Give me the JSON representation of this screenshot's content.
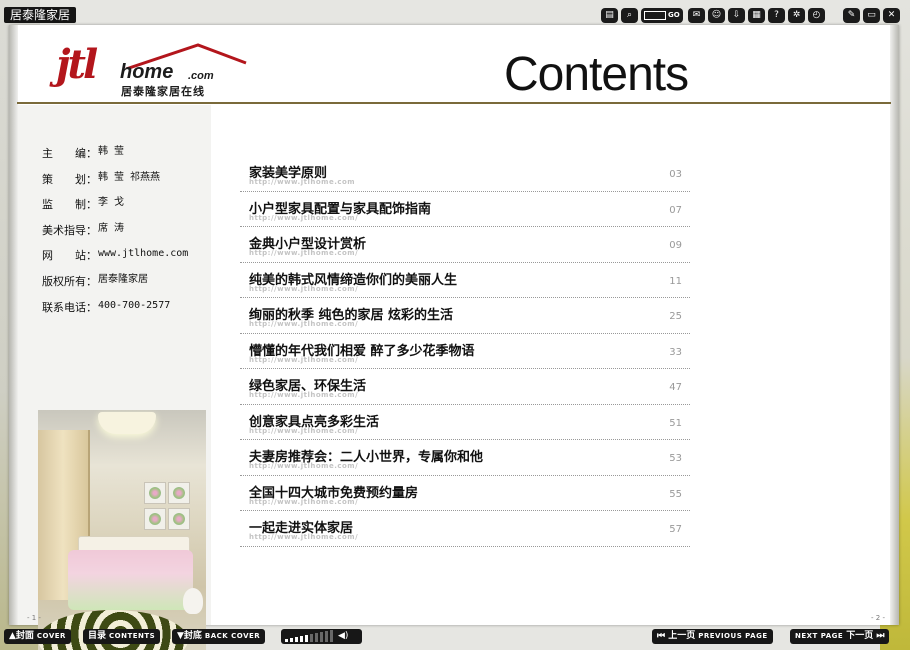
{
  "window": {
    "title": "居泰隆家居"
  },
  "toolbar": {
    "go_label": "GO",
    "buttons": [
      {
        "name": "thumbnails-icon",
        "glyph": "▤"
      },
      {
        "name": "zoom-icon",
        "glyph": "⌕"
      },
      {
        "name": "comment-icon",
        "glyph": "✉"
      },
      {
        "name": "user-icon",
        "glyph": "☺"
      },
      {
        "name": "download-icon",
        "glyph": "⇩"
      },
      {
        "name": "print-icon",
        "glyph": "▦"
      },
      {
        "name": "help-icon",
        "glyph": "?"
      },
      {
        "name": "settings-icon",
        "glyph": "✲"
      },
      {
        "name": "autoplay-icon",
        "glyph": "◴"
      },
      {
        "name": "edit-icon",
        "glyph": "✎"
      },
      {
        "name": "fullscreen-icon",
        "glyph": "▭"
      },
      {
        "name": "close-icon",
        "glyph": "✕"
      }
    ]
  },
  "header": {
    "logo_jtl": "jtl",
    "logo_home": "home",
    "logo_com": ".com",
    "logo_cn": "居泰隆家居在线",
    "contents_title": "Contents"
  },
  "credits": [
    {
      "label": "主　　编：",
      "value": "韩 莹"
    },
    {
      "label": "策　　划：",
      "value": "韩 莹  祁燕燕"
    },
    {
      "label": "监　　制：",
      "value": "李 戈"
    },
    {
      "label": "美术指导：",
      "value": "席 涛"
    },
    {
      "label": "网　　站：",
      "value": "www.jtlhome.com"
    },
    {
      "label": "版权所有：",
      "value": "居泰隆家居"
    },
    {
      "label": "联系电话：",
      "value": "400-700-2577"
    }
  ],
  "toc": [
    {
      "title": "家装美学原则",
      "url": "http://www.jtlhome.com",
      "page": "03"
    },
    {
      "title": "小户型家具配置与家具配饰指南",
      "url": "http://www.jtlhome.com/",
      "page": "07"
    },
    {
      "title": "金典小户型设计赏析",
      "url": "http://www.jtlhome.com/",
      "page": "09"
    },
    {
      "title": "纯美的韩式风情缔造你们的美丽人生",
      "url": "http://www.jtlhome.com/",
      "page": "11"
    },
    {
      "title": "绚丽的秋季  纯色的家居  炫彩的生活",
      "url": "http://www.jtlhome.com/",
      "page": "25"
    },
    {
      "title": "懵懂的年代我们相爱  醉了多少花季物语",
      "url": "http://www.jtlhome.com/",
      "page": "33"
    },
    {
      "title": "绿色家居、环保生活",
      "url": "http://www.jtlhome.com/",
      "page": "47"
    },
    {
      "title": "创意家具点亮多彩生活",
      "url": "http://www.jtlhome.com/",
      "page": "51"
    },
    {
      "title": "夫妻房推荐会：二人小世界，专属你和他",
      "url": "http://www.jtlhome.com/",
      "page": "53"
    },
    {
      "title": "全国十四大城市免费预约量房",
      "url": "http://www.jtlhome.com/",
      "page": "55"
    },
    {
      "title": "一起走进实体家居",
      "url": "http://www.jtlhome.com/",
      "page": "57"
    }
  ],
  "pages": {
    "left": "- 1 -",
    "right": "- 2 -"
  },
  "bottom": {
    "cover_cn": "▲封面",
    "cover_en": "COVER",
    "contents_cn": "目录",
    "contents_en": "CONTENTS",
    "back_cn": "▼封底",
    "back_en": "BACK COVER",
    "prev_cn": "⏮ 上一页",
    "prev_en": "PREVIOUS PAGE",
    "next_en": "NEXT PAGE",
    "next_cn": "下一页 ⏭",
    "volume_level": 0.45
  },
  "colors": {
    "brand_red": "#b3161c",
    "rule_gold": "#7a6a3a",
    "bar_dark": "#171717"
  }
}
